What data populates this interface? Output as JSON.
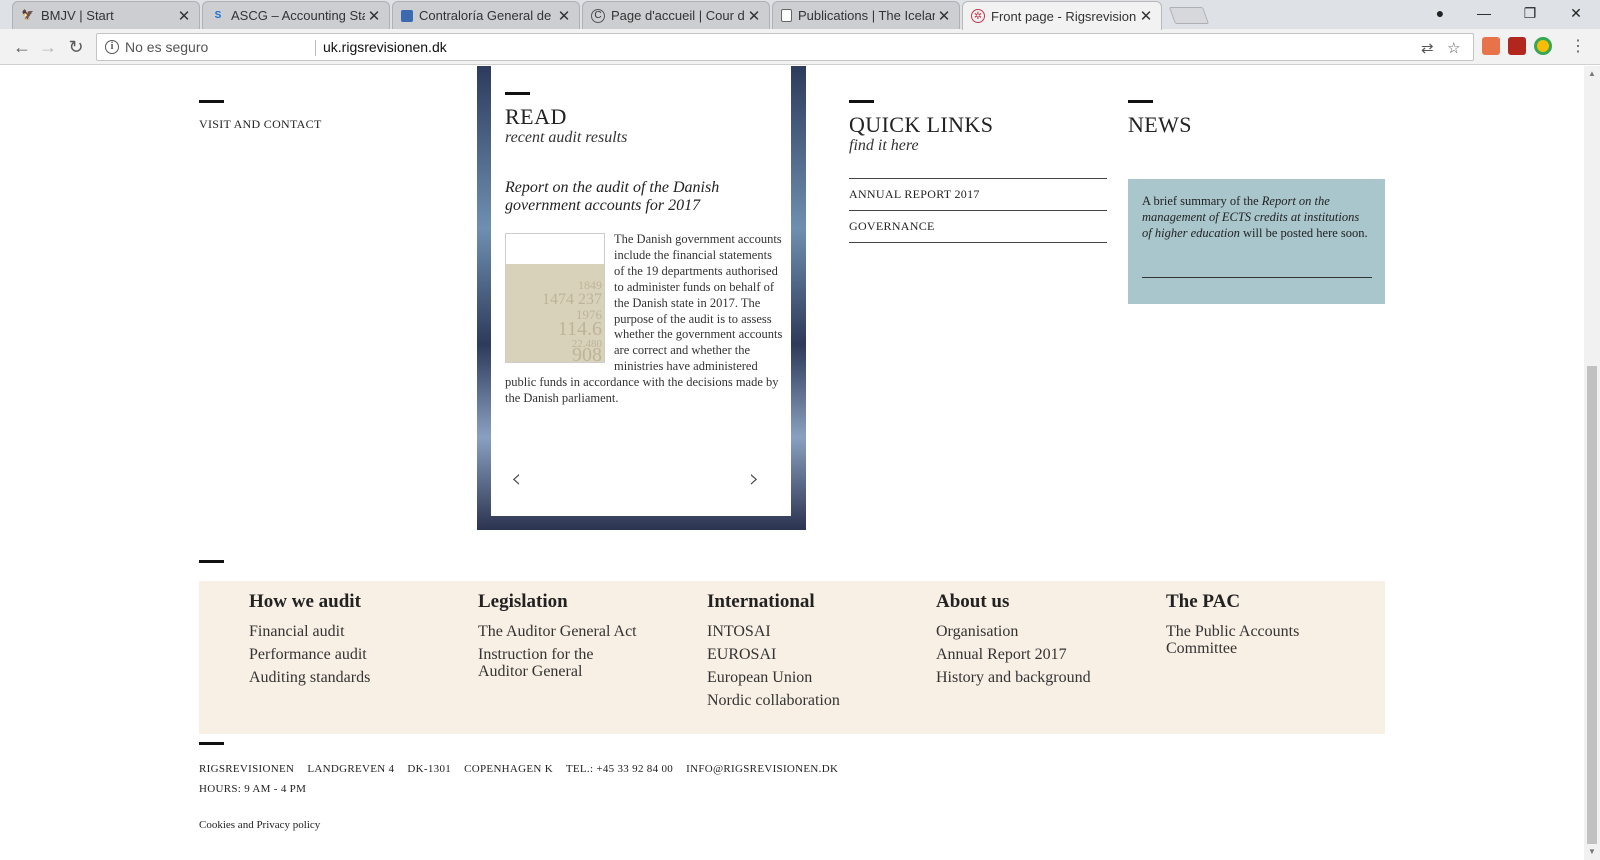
{
  "browser": {
    "tabs": [
      {
        "title": "BMJV | Start",
        "icon": "eagle-icon",
        "active": false
      },
      {
        "title": "ASCG – Accounting Standa",
        "icon": "ascg-logo-icon",
        "active": false
      },
      {
        "title": "Contraloría General de la",
        "icon": "document-icon",
        "active": false
      },
      {
        "title": "Page d'accueil | Cour des",
        "icon": "cour-des-comptes-icon",
        "active": false
      },
      {
        "title": "Publications | The Iceland",
        "icon": "page-icon",
        "active": false
      },
      {
        "title": "Front page - Rigsrevision",
        "icon": "rigsrevisionen-logo-icon",
        "active": true
      }
    ],
    "security_label": "No es seguro",
    "url": "uk.rigsrevisionen.dk"
  },
  "visit": {
    "label": "VISIT AND CONTACT"
  },
  "read": {
    "title": "READ",
    "subtitle": "recent audit results",
    "report_title": "Report on the audit of the Danish government accounts for 2017",
    "report_text": "The Danish government accounts include the financial statements of the 19 departments authorised to administer funds on behalf of the Danish state in 2017. The purpose of the audit is to assess whether the government accounts are correct and whether the ministries have administered public funds in accordance with the decisions made by the Danish parliament.",
    "cover_numbers": [
      "1849",
      "1474 237",
      "1976",
      "114.6",
      "22.480",
      "908"
    ],
    "prev_arrow": "‹",
    "next_arrow": "›"
  },
  "quick_links": {
    "title": "QUICK LINKS",
    "subtitle": "find it here",
    "items": [
      "ANNUAL REPORT 2017",
      "GOVERNANCE"
    ]
  },
  "news": {
    "title": "NEWS",
    "text_before": "A brief summary of the ",
    "text_italic": "Report on the management of ECTS credits at institutions of higher education",
    "text_after": " will be posted here soon."
  },
  "footer_nav": {
    "columns": [
      {
        "heading": "How we audit",
        "links": [
          "Financial audit",
          "Performance audit",
          "Auditing standards"
        ]
      },
      {
        "heading": "Legislation",
        "links": [
          "The Auditor General Act",
          "Instruction for the Auditor General"
        ]
      },
      {
        "heading": "International",
        "links": [
          "INTOSAI",
          "EUROSAI",
          "European Union",
          "Nordic collaboration"
        ]
      },
      {
        "heading": "About us",
        "links": [
          "Organisation",
          "Annual Report 2017",
          "History and background"
        ]
      },
      {
        "heading": "The PAC",
        "links": [
          "The Public Accounts Committee"
        ]
      }
    ]
  },
  "address": {
    "parts": [
      "RIGSREVISIONEN",
      "LANDGREVEN 4",
      "DK-1301",
      "COPENHAGEN K",
      "TEL.: +45 33 92 84 00",
      "INFO@RIGSREVISIONEN.DK"
    ],
    "hours": "HOURS: 9 AM - 4 PM",
    "cookies": "Cookies and Privacy policy"
  }
}
